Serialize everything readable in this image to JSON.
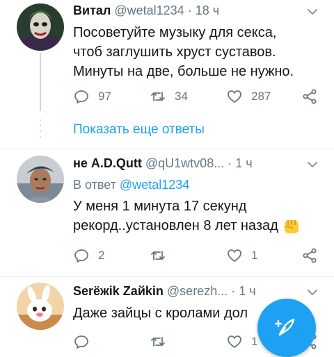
{
  "tweets": [
    {
      "name": "Витал",
      "handle": "@wetal1234",
      "dot": "·",
      "time": "18 ч",
      "lines": [
        "Посоветуйте музыку для  секса,",
        "чтоб заглушить хруст суставов.",
        "Минуты на две, больше не нужно."
      ],
      "reply_count": "97",
      "retweet_count": "34",
      "like_count": "287"
    },
    {
      "name": "не A.D.Qutt",
      "handle": "@qU1wtv08...",
      "dot": "·",
      "time": "1 ч",
      "reply_prefix": "В ответ",
      "reply_mention": "@wetal1234",
      "lines": [
        "У меня 1 минута 17 секунд",
        "рекорд..установлен 8 лет назад"
      ],
      "reply_count": "2",
      "retweet_count": "",
      "like_count": "1"
    },
    {
      "name": "Serёжik Zайkin",
      "handle": "@serezh...",
      "dot": "·",
      "time": "1 ч",
      "lines": [
        "Даже зайцы с кролами дол"
      ],
      "reply_count": "",
      "retweet_count": "",
      "like_count": "1"
    }
  ],
  "show_more": "Показать еще ответы",
  "icons": {
    "reply": "reply-icon",
    "retweet": "retweet-icon",
    "like": "like-icon",
    "share": "share-icon",
    "chevron": "chevron-down-icon",
    "compose": "compose-tweet-icon",
    "emoji": "fist-emoji-icon"
  },
  "colors": {
    "accent": "#1da1f2",
    "muted": "#657786",
    "text": "#14171a"
  }
}
